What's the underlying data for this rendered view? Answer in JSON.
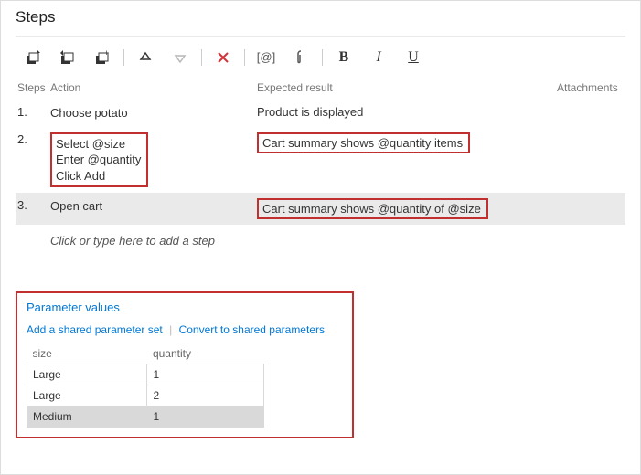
{
  "title": "Steps",
  "columns": {
    "step": "Steps",
    "action": "Action",
    "expected": "Expected result",
    "attachments": "Attachments"
  },
  "rows": [
    {
      "num": "1.",
      "action": "Choose potato",
      "expected": "Product is displayed",
      "highlight": false,
      "selected": false
    },
    {
      "num": "2.",
      "action": "Select @size\nEnter @quantity\nClick Add",
      "expected": "Cart summary shows @quantity items",
      "highlight": true,
      "selected": false
    },
    {
      "num": "3.",
      "action": "Open cart",
      "expected": "Cart summary shows @quantity of @size",
      "highlight": true,
      "highlight_expected_only": true,
      "selected": true
    }
  ],
  "add_placeholder": "Click or type here to add a step",
  "params": {
    "title": "Parameter values",
    "link_add": "Add a shared parameter set",
    "link_convert": "Convert to shared parameters",
    "headers": {
      "size": "size",
      "quantity": "quantity"
    },
    "rows": [
      {
        "size": "Large",
        "quantity": "1",
        "selected": false
      },
      {
        "size": "Large",
        "quantity": "2",
        "selected": false
      },
      {
        "size": "Medium",
        "quantity": "1",
        "selected": true
      }
    ]
  }
}
